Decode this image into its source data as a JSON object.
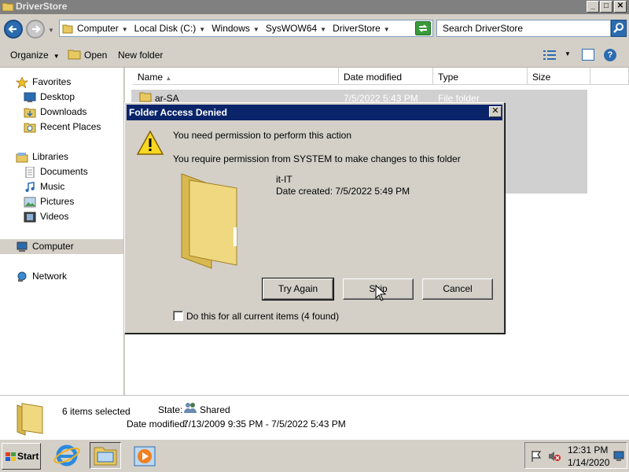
{
  "window": {
    "title": "DriverStore",
    "buttons": {
      "minimize": "_",
      "maximize": "□",
      "close": "✕"
    }
  },
  "address_bar": {
    "breadcrumbs": [
      "Computer",
      "Local Disk (C:)",
      "Windows",
      "SysWOW64",
      "DriverStore"
    ],
    "search_placeholder": "Search DriverStore"
  },
  "command_bar": {
    "organize": "Organize",
    "open": "Open",
    "new_folder": "New folder"
  },
  "nav_pane": {
    "favorites": {
      "label": "Favorites",
      "items": [
        "Desktop",
        "Downloads",
        "Recent Places"
      ]
    },
    "libraries": {
      "label": "Libraries",
      "items": [
        "Documents",
        "Music",
        "Pictures",
        "Videos"
      ]
    },
    "computer": "Computer",
    "network": "Network"
  },
  "file_list": {
    "columns": [
      "Name",
      "Date modified",
      "Type",
      "Size"
    ],
    "rows": [
      {
        "name": "ar-SA",
        "date": "7/5/2022 5:43 PM",
        "type": "File folder"
      }
    ]
  },
  "details_pane": {
    "selected": "6 items selected",
    "state_label": "State:",
    "state_value": "Shared",
    "date_modified_label": "Date modified:",
    "date_modified_value": "7/13/2009 9:35 PM - 7/5/2022 5:43 PM"
  },
  "dialog": {
    "title": "Folder Access Denied",
    "close": "✕",
    "message": "You need permission to perform this action",
    "detail": "You require permission from SYSTEM to make changes to this folder",
    "folder_name": "it-IT",
    "folder_created": "Date created: 7/5/2022 5:49 PM",
    "buttons": {
      "try_again": "Try Again",
      "skip": "Skip",
      "cancel": "Cancel"
    },
    "checkbox_label": "Do this for all current items (4 found)",
    "checkbox_checked": false
  },
  "taskbar": {
    "start": "Start",
    "clock_time": "12:31 PM",
    "clock_date": "1/14/2020"
  }
}
